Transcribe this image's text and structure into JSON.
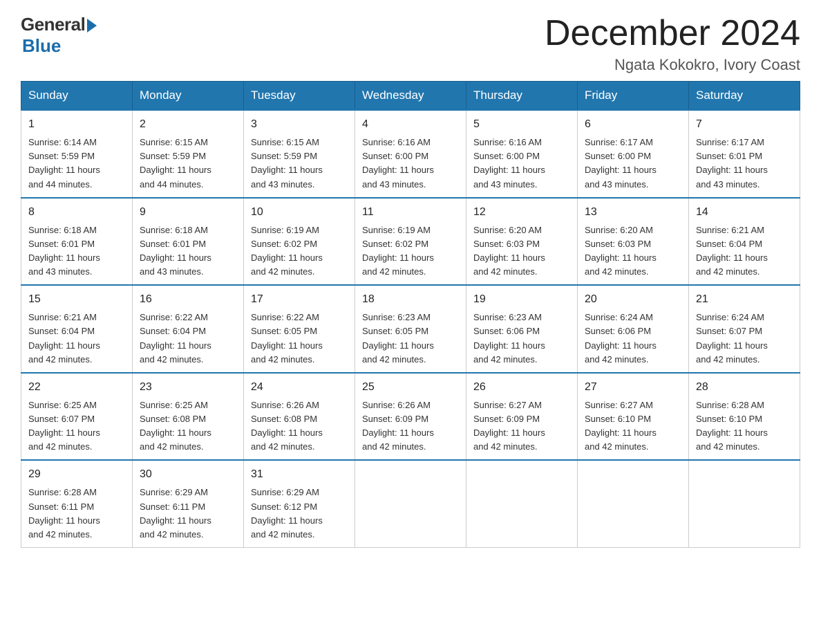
{
  "logo": {
    "general": "General",
    "blue": "Blue"
  },
  "title": "December 2024",
  "location": "Ngata Kokokro, Ivory Coast",
  "days_of_week": [
    "Sunday",
    "Monday",
    "Tuesday",
    "Wednesday",
    "Thursday",
    "Friday",
    "Saturday"
  ],
  "weeks": [
    [
      {
        "day": "1",
        "sunrise": "6:14 AM",
        "sunset": "5:59 PM",
        "daylight": "11 hours and 44 minutes."
      },
      {
        "day": "2",
        "sunrise": "6:15 AM",
        "sunset": "5:59 PM",
        "daylight": "11 hours and 44 minutes."
      },
      {
        "day": "3",
        "sunrise": "6:15 AM",
        "sunset": "5:59 PM",
        "daylight": "11 hours and 43 minutes."
      },
      {
        "day": "4",
        "sunrise": "6:16 AM",
        "sunset": "6:00 PM",
        "daylight": "11 hours and 43 minutes."
      },
      {
        "day": "5",
        "sunrise": "6:16 AM",
        "sunset": "6:00 PM",
        "daylight": "11 hours and 43 minutes."
      },
      {
        "day": "6",
        "sunrise": "6:17 AM",
        "sunset": "6:00 PM",
        "daylight": "11 hours and 43 minutes."
      },
      {
        "day": "7",
        "sunrise": "6:17 AM",
        "sunset": "6:01 PM",
        "daylight": "11 hours and 43 minutes."
      }
    ],
    [
      {
        "day": "8",
        "sunrise": "6:18 AM",
        "sunset": "6:01 PM",
        "daylight": "11 hours and 43 minutes."
      },
      {
        "day": "9",
        "sunrise": "6:18 AM",
        "sunset": "6:01 PM",
        "daylight": "11 hours and 43 minutes."
      },
      {
        "day": "10",
        "sunrise": "6:19 AM",
        "sunset": "6:02 PM",
        "daylight": "11 hours and 42 minutes."
      },
      {
        "day": "11",
        "sunrise": "6:19 AM",
        "sunset": "6:02 PM",
        "daylight": "11 hours and 42 minutes."
      },
      {
        "day": "12",
        "sunrise": "6:20 AM",
        "sunset": "6:03 PM",
        "daylight": "11 hours and 42 minutes."
      },
      {
        "day": "13",
        "sunrise": "6:20 AM",
        "sunset": "6:03 PM",
        "daylight": "11 hours and 42 minutes."
      },
      {
        "day": "14",
        "sunrise": "6:21 AM",
        "sunset": "6:04 PM",
        "daylight": "11 hours and 42 minutes."
      }
    ],
    [
      {
        "day": "15",
        "sunrise": "6:21 AM",
        "sunset": "6:04 PM",
        "daylight": "11 hours and 42 minutes."
      },
      {
        "day": "16",
        "sunrise": "6:22 AM",
        "sunset": "6:04 PM",
        "daylight": "11 hours and 42 minutes."
      },
      {
        "day": "17",
        "sunrise": "6:22 AM",
        "sunset": "6:05 PM",
        "daylight": "11 hours and 42 minutes."
      },
      {
        "day": "18",
        "sunrise": "6:23 AM",
        "sunset": "6:05 PM",
        "daylight": "11 hours and 42 minutes."
      },
      {
        "day": "19",
        "sunrise": "6:23 AM",
        "sunset": "6:06 PM",
        "daylight": "11 hours and 42 minutes."
      },
      {
        "day": "20",
        "sunrise": "6:24 AM",
        "sunset": "6:06 PM",
        "daylight": "11 hours and 42 minutes."
      },
      {
        "day": "21",
        "sunrise": "6:24 AM",
        "sunset": "6:07 PM",
        "daylight": "11 hours and 42 minutes."
      }
    ],
    [
      {
        "day": "22",
        "sunrise": "6:25 AM",
        "sunset": "6:07 PM",
        "daylight": "11 hours and 42 minutes."
      },
      {
        "day": "23",
        "sunrise": "6:25 AM",
        "sunset": "6:08 PM",
        "daylight": "11 hours and 42 minutes."
      },
      {
        "day": "24",
        "sunrise": "6:26 AM",
        "sunset": "6:08 PM",
        "daylight": "11 hours and 42 minutes."
      },
      {
        "day": "25",
        "sunrise": "6:26 AM",
        "sunset": "6:09 PM",
        "daylight": "11 hours and 42 minutes."
      },
      {
        "day": "26",
        "sunrise": "6:27 AM",
        "sunset": "6:09 PM",
        "daylight": "11 hours and 42 minutes."
      },
      {
        "day": "27",
        "sunrise": "6:27 AM",
        "sunset": "6:10 PM",
        "daylight": "11 hours and 42 minutes."
      },
      {
        "day": "28",
        "sunrise": "6:28 AM",
        "sunset": "6:10 PM",
        "daylight": "11 hours and 42 minutes."
      }
    ],
    [
      {
        "day": "29",
        "sunrise": "6:28 AM",
        "sunset": "6:11 PM",
        "daylight": "11 hours and 42 minutes."
      },
      {
        "day": "30",
        "sunrise": "6:29 AM",
        "sunset": "6:11 PM",
        "daylight": "11 hours and 42 minutes."
      },
      {
        "day": "31",
        "sunrise": "6:29 AM",
        "sunset": "6:12 PM",
        "daylight": "11 hours and 42 minutes."
      },
      null,
      null,
      null,
      null
    ]
  ],
  "labels": {
    "sunrise": "Sunrise:",
    "sunset": "Sunset:",
    "daylight": "Daylight:"
  }
}
